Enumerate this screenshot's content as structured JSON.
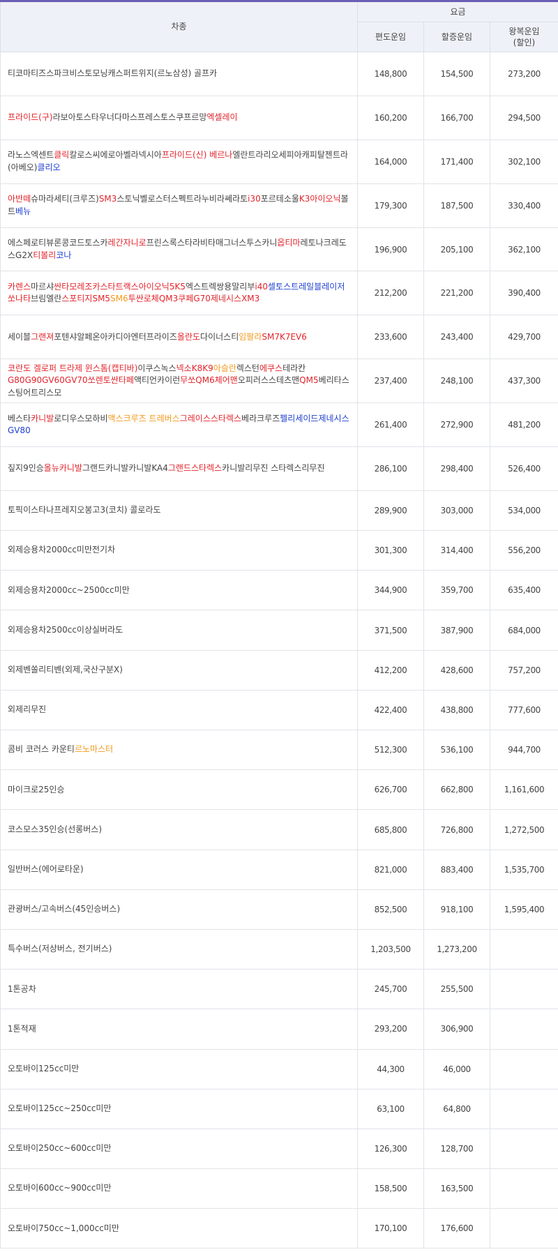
{
  "header": {
    "vehicle": "차종",
    "fare_group": "요금",
    "one_way": "편도운임",
    "surcharge": "할증운임",
    "round_trip_line1": "왕복운임",
    "round_trip_line2": "(할인)"
  },
  "colors": {
    "accent_bar": "#6b5fb5",
    "highlight_red": "#e3242b",
    "highlight_orange": "#f29a1d",
    "highlight_blue": "#1f3fd1"
  },
  "rows": [
    {
      "segments": [
        {
          "text": "티코마티즈스파크비스토모닝캐스퍼트위지(르노삼성) 골프카",
          "c": ""
        }
      ],
      "one_way": "148,800",
      "surcharge": "154,500",
      "round_trip": "273,200"
    },
    {
      "segments": [
        {
          "text": "프라이드(구)",
          "c": "red"
        },
        {
          "text": "라보아토스타우너다마스프레스토스쿠프르망",
          "c": ""
        },
        {
          "text": "엑셀레이",
          "c": "red"
        }
      ],
      "one_way": "160,200",
      "surcharge": "166,700",
      "round_trip": "294,500"
    },
    {
      "segments": [
        {
          "text": "라노스엑센트",
          "c": ""
        },
        {
          "text": "클릭",
          "c": "red"
        },
        {
          "text": "칼로스씨에로아벨라넥시아",
          "c": ""
        },
        {
          "text": "프라이드(신) 베르나",
          "c": "red"
        },
        {
          "text": "엘란트라리오세피아캐피탈젠트라(아베오)",
          "c": ""
        },
        {
          "text": "클리오",
          "c": "blue"
        }
      ],
      "one_way": "164,000",
      "surcharge": "171,400",
      "round_trip": "302,100"
    },
    {
      "segments": [
        {
          "text": "아반떼",
          "c": "red"
        },
        {
          "text": "슈마라세티(크루즈)",
          "c": ""
        },
        {
          "text": "SM3",
          "c": "red"
        },
        {
          "text": "스토닉벨로스터스펙트라누비라쎄라토",
          "c": ""
        },
        {
          "text": "i30",
          "c": "red"
        },
        {
          "text": "포르테소울",
          "c": ""
        },
        {
          "text": "K3아이오닉",
          "c": "red"
        },
        {
          "text": "볼트",
          "c": ""
        },
        {
          "text": "베뉴",
          "c": "blue"
        }
      ],
      "one_way": "179,300",
      "surcharge": "187,500",
      "round_trip": "330,400"
    },
    {
      "segments": [
        {
          "text": "에스페로티뷰론콩코드토스카",
          "c": ""
        },
        {
          "text": "레간자니로",
          "c": "red"
        },
        {
          "text": "프린스록스타라비타매그너스투스카니",
          "c": ""
        },
        {
          "text": "옵티마",
          "c": "red"
        },
        {
          "text": "레토나크레도스G2X",
          "c": ""
        },
        {
          "text": "티볼리",
          "c": "red"
        },
        {
          "text": "코나",
          "c": "blue"
        }
      ],
      "one_way": "196,900",
      "surcharge": "205,100",
      "round_trip": "362,100"
    },
    {
      "segments": [
        {
          "text": "카렌스",
          "c": "red"
        },
        {
          "text": "마르샤",
          "c": ""
        },
        {
          "text": "싼타모레조카스타트랙스아이오닉5K5",
          "c": "red"
        },
        {
          "text": "엑스트렉쌍용말리부",
          "c": ""
        },
        {
          "text": "i40",
          "c": "red"
        },
        {
          "text": "셀토스트레일블레이저",
          "c": "blue"
        },
        {
          "text": "쏘나타",
          "c": "red"
        },
        {
          "text": "브림엘란",
          "c": ""
        },
        {
          "text": "스포티지SM5",
          "c": "red"
        },
        {
          "text": "SM6",
          "c": "orange"
        },
        {
          "text": "투싼로체QM3쿠페G70제네시스XM3",
          "c": "red"
        }
      ],
      "one_way": "212,200",
      "surcharge": "221,200",
      "round_trip": "390,400"
    },
    {
      "segments": [
        {
          "text": "세이블",
          "c": ""
        },
        {
          "text": "그랜져",
          "c": "red"
        },
        {
          "text": "포텐샤알페온아카디아엔터프라이즈",
          "c": ""
        },
        {
          "text": "올란도",
          "c": "red"
        },
        {
          "text": "다이너스티",
          "c": ""
        },
        {
          "text": "임팔라",
          "c": "orange"
        },
        {
          "text": "SM7K7EV6",
          "c": "red"
        }
      ],
      "one_way": "233,600",
      "surcharge": "243,400",
      "round_trip": "429,700"
    },
    {
      "segments": [
        {
          "text": "코란도 겔로퍼 트라제 윈스톰(캡티바)",
          "c": "red"
        },
        {
          "text": "이쿠스녹스",
          "c": ""
        },
        {
          "text": "넥소K8K9",
          "c": "red"
        },
        {
          "text": "아슬란",
          "c": "orange"
        },
        {
          "text": "렉스턴",
          "c": ""
        },
        {
          "text": "에쿠스",
          "c": "red"
        },
        {
          "text": "테라칸",
          "c": ""
        },
        {
          "text": "G80G90GV60GV70쏘렌토싼타페",
          "c": "red"
        },
        {
          "text": "액티언카이런",
          "c": ""
        },
        {
          "text": "무쏘QM6체어맨",
          "c": "red"
        },
        {
          "text": "오피러스스테츠맨",
          "c": ""
        },
        {
          "text": "QM5",
          "c": "red"
        },
        {
          "text": "베리타스스팅어트리스모",
          "c": ""
        }
      ],
      "one_way": "237,400",
      "surcharge": "248,100",
      "round_trip": "437,300"
    },
    {
      "segments": [
        {
          "text": "베스타",
          "c": ""
        },
        {
          "text": "카니발",
          "c": "red"
        },
        {
          "text": "로디우스모하비",
          "c": ""
        },
        {
          "text": "맥스크루즈 트레버스",
          "c": "orange"
        },
        {
          "text": "그레이스스타렉스",
          "c": "red"
        },
        {
          "text": "베라크루즈",
          "c": ""
        },
        {
          "text": "펠리세이드제네시스GV80",
          "c": "blue"
        }
      ],
      "one_way": "261,400",
      "surcharge": "272,900",
      "round_trip": "481,200"
    },
    {
      "segments": [
        {
          "text": "짚지9인승",
          "c": ""
        },
        {
          "text": "올뉴카니발",
          "c": "red"
        },
        {
          "text": "그랜드카니발카니발KA4",
          "c": ""
        },
        {
          "text": "그랜드스타렉스",
          "c": "red"
        },
        {
          "text": "카니발리무진 스타렉스리무진",
          "c": ""
        }
      ],
      "one_way": "286,100",
      "surcharge": "298,400",
      "round_trip": "526,400"
    },
    {
      "segments": [
        {
          "text": "토픽이스타나프레지오봉고3(코치) 콜로라도",
          "c": ""
        }
      ],
      "one_way": "289,900",
      "surcharge": "303,000",
      "round_trip": "534,000"
    },
    {
      "segments": [
        {
          "text": "외제승용차2000cc미만전기차",
          "c": ""
        }
      ],
      "one_way": "301,300",
      "surcharge": "314,400",
      "round_trip": "556,200"
    },
    {
      "segments": [
        {
          "text": "외제승용차2000cc~2500cc미만",
          "c": ""
        }
      ],
      "one_way": "344,900",
      "surcharge": "359,700",
      "round_trip": "635,400"
    },
    {
      "segments": [
        {
          "text": "외제승용차2500cc이상실버라도",
          "c": ""
        }
      ],
      "one_way": "371,500",
      "surcharge": "387,900",
      "round_trip": "684,000"
    },
    {
      "segments": [
        {
          "text": "외제벤쏠리티벤(외제,국산구분X)",
          "c": ""
        }
      ],
      "one_way": "412,200",
      "surcharge": "428,600",
      "round_trip": "757,200"
    },
    {
      "segments": [
        {
          "text": "외제리무진",
          "c": ""
        }
      ],
      "one_way": "422,400",
      "surcharge": "438,800",
      "round_trip": "777,600"
    },
    {
      "segments": [
        {
          "text": "콤비 코러스 카운티",
          "c": ""
        },
        {
          "text": "르노마스터",
          "c": "orange"
        }
      ],
      "one_way": "512,300",
      "surcharge": "536,100",
      "round_trip": "944,700"
    },
    {
      "segments": [
        {
          "text": "마이크로25인승",
          "c": ""
        }
      ],
      "one_way": "626,700",
      "surcharge": "662,800",
      "round_trip": "1,161,600"
    },
    {
      "segments": [
        {
          "text": "코스모스35인승(선롱버스)",
          "c": ""
        }
      ],
      "one_way": "685,800",
      "surcharge": "726,800",
      "round_trip": "1,272,500"
    },
    {
      "segments": [
        {
          "text": "일반버스(에어로타운)",
          "c": ""
        }
      ],
      "one_way": "821,000",
      "surcharge": "883,400",
      "round_trip": "1,535,700"
    },
    {
      "segments": [
        {
          "text": "관광버스/고속버스(45인승버스)",
          "c": ""
        }
      ],
      "one_way": "852,500",
      "surcharge": "918,100",
      "round_trip": "1,595,400"
    },
    {
      "segments": [
        {
          "text": "특수버스(저상버스, 전기버스)",
          "c": ""
        }
      ],
      "one_way": "1,203,500",
      "surcharge": "1,273,200",
      "round_trip": ""
    },
    {
      "segments": [
        {
          "text": "1톤공차",
          "c": ""
        }
      ],
      "one_way": "245,700",
      "surcharge": "255,500",
      "round_trip": ""
    },
    {
      "segments": [
        {
          "text": "1톤적재",
          "c": ""
        }
      ],
      "one_way": "293,200",
      "surcharge": "306,900",
      "round_trip": ""
    },
    {
      "segments": [
        {
          "text": "오토바이125cc미만",
          "c": ""
        }
      ],
      "one_way": "44,300",
      "surcharge": "46,000",
      "round_trip": ""
    },
    {
      "segments": [
        {
          "text": "오토바이125cc~250cc미만",
          "c": ""
        }
      ],
      "one_way": "63,100",
      "surcharge": "64,800",
      "round_trip": ""
    },
    {
      "segments": [
        {
          "text": "오토바이250cc~600cc미만",
          "c": ""
        }
      ],
      "one_way": "126,300",
      "surcharge": "128,700",
      "round_trip": ""
    },
    {
      "segments": [
        {
          "text": "오토바이600cc~900cc미만",
          "c": ""
        }
      ],
      "one_way": "158,500",
      "surcharge": "163,500",
      "round_trip": ""
    },
    {
      "segments": [
        {
          "text": "오토바이750cc~1,000cc미만",
          "c": ""
        }
      ],
      "one_way": "170,100",
      "surcharge": "176,600",
      "round_trip": ""
    }
  ]
}
